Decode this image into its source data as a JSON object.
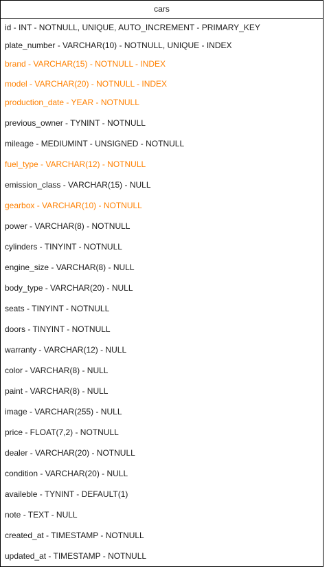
{
  "entity": {
    "name": "cars",
    "highlight_color": "#ff8000",
    "text_color": "#1a1a1a",
    "fields": [
      {
        "text": "id - INT - NOTNULL, UNIQUE, AUTO_INCREMENT - PRIMARY_KEY",
        "highlight": false
      },
      {
        "text": "plate_number - VARCHAR(10) - NOTNULL, UNIQUE - INDEX",
        "highlight": false
      },
      {
        "text": "brand - VARCHAR(15) - NOTNULL - INDEX",
        "highlight": true
      },
      {
        "text": "model - VARCHAR(20) - NOTNULL - INDEX",
        "highlight": true
      },
      {
        "text": "production_date - YEAR - NOTNULL",
        "highlight": true
      },
      {
        "text": "previous_owner - TYNINT - NOTNULL",
        "highlight": false
      },
      {
        "text": "mileage - MEDIUMINT - UNSIGNED - NOTNULL",
        "highlight": false
      },
      {
        "text": "fuel_type - VARCHAR(12) - NOTNULL",
        "highlight": true
      },
      {
        "text": "emission_class - VARCHAR(15) - NULL",
        "highlight": false
      },
      {
        "text": "gearbox - VARCHAR(10) - NOTNULL",
        "highlight": true
      },
      {
        "text": "power - VARCHAR(8) - NOTNULL",
        "highlight": false
      },
      {
        "text": "cylinders - TINYINT - NOTNULL",
        "highlight": false
      },
      {
        "text": "engine_size - VARCHAR(8) - NULL",
        "highlight": false
      },
      {
        "text": "body_type - VARCHAR(20) - NULL",
        "highlight": false
      },
      {
        "text": "seats - TINYINT - NOTNULL",
        "highlight": false
      },
      {
        "text": "doors - TINYINT - NOTNULL",
        "highlight": false
      },
      {
        "text": "warranty - VARCHAR(12) - NULL",
        "highlight": false
      },
      {
        "text": "color - VARCHAR(8) - NULL",
        "highlight": false
      },
      {
        "text": "paint - VARCHAR(8) - NULL",
        "highlight": false
      },
      {
        "text": "image - VARCHAR(255) - NULL",
        "highlight": false
      },
      {
        "text": "price - FLOAT(7,2) - NOTNULL",
        "highlight": false
      },
      {
        "text": "dealer - VARCHAR(20) - NOTNULL",
        "highlight": false
      },
      {
        "text": "condition - VARCHAR(20) - NULL",
        "highlight": false
      },
      {
        "text": "availeble - TYNINT - DEFAULT(1)",
        "highlight": false
      },
      {
        "text": "note - TEXT - NULL",
        "highlight": false
      },
      {
        "text": "created_at - TIMESTAMP - NOTNULL",
        "highlight": false
      },
      {
        "text": "updated_at - TIMESTAMP - NOTNULL",
        "highlight": false
      }
    ]
  }
}
